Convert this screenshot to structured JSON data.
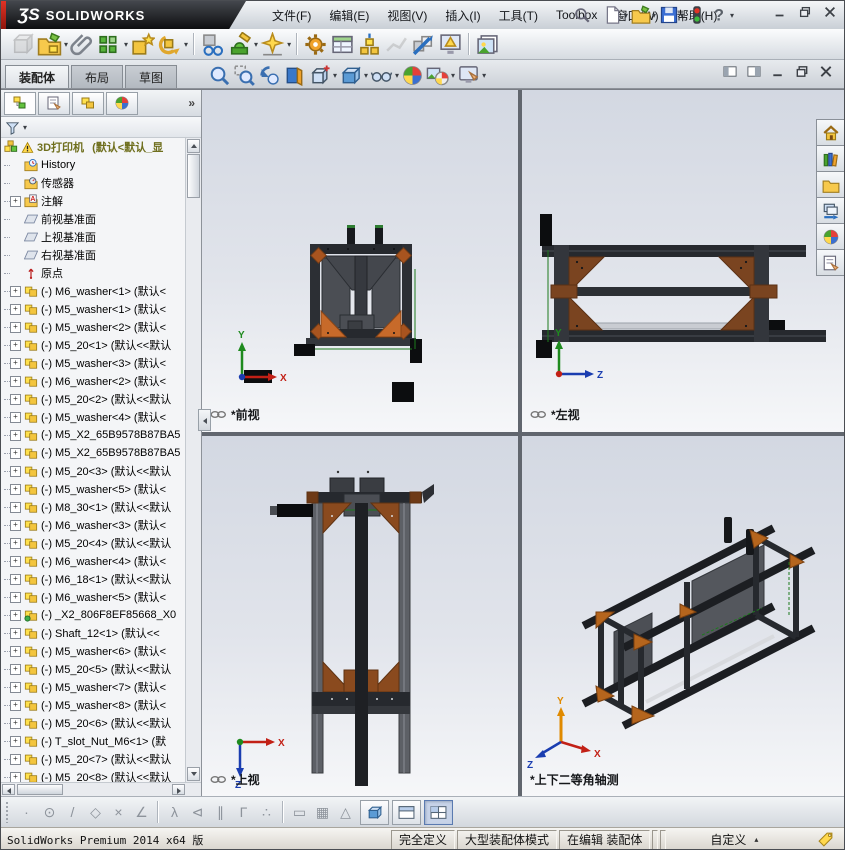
{
  "window": {
    "logo_glyph": "ƷS",
    "brand": "SOLIDWORKS",
    "menus": [
      "文件(F)",
      "编辑(E)",
      "视图(V)",
      "插入(I)",
      "工具(T)",
      "Toolbox",
      "窗口(W)",
      "帮助(H)"
    ],
    "quick_icons": [
      {
        "name": "new-document",
        "dropdown": true
      },
      {
        "name": "open-document",
        "dropdown": true
      },
      {
        "name": "save-document",
        "dropdown": true
      },
      {
        "name": "rebuild-indicator",
        "dropdown": false
      },
      {
        "name": "help",
        "dropdown": true
      }
    ],
    "controls": [
      {
        "name": "minimize"
      },
      {
        "name": "restore"
      },
      {
        "name": "close"
      }
    ]
  },
  "assembly_toolbar": [
    {
      "name": "insert-component",
      "disabled": true
    },
    {
      "name": "insert-components",
      "dropdown": true
    },
    {
      "name": "mate"
    },
    {
      "name": "linear-component-pattern",
      "dropdown": true
    },
    {
      "name": "smart-fasteners"
    },
    {
      "name": "move-component",
      "dropdown": true
    },
    {
      "sep": true
    },
    {
      "name": "show-hidden-components"
    },
    {
      "name": "assembly-features",
      "dropdown": true
    },
    {
      "name": "reference-geometry",
      "dropdown": true
    },
    {
      "sep": true
    },
    {
      "name": "new-motion-study"
    },
    {
      "name": "bill-of-materials"
    },
    {
      "name": "exploded-view"
    },
    {
      "name": "explode-line-sketch",
      "disabled": true
    },
    {
      "name": "interference-detection"
    },
    {
      "name": "assembly-visualization"
    },
    {
      "sep": true
    },
    {
      "name": "take-snapshot"
    }
  ],
  "command_tabs": [
    {
      "label": "装配体",
      "active": true
    },
    {
      "label": "布局",
      "active": false
    },
    {
      "label": "草图",
      "active": false
    }
  ],
  "view_toolbar": [
    {
      "name": "zoom-to-fit"
    },
    {
      "name": "zoom-to-area"
    },
    {
      "name": "previous-view"
    },
    {
      "name": "section-view"
    },
    {
      "name": "view-orientation",
      "dropdown": true
    },
    {
      "name": "display-style",
      "dropdown": true
    },
    {
      "name": "hide-show-items",
      "dropdown": true
    },
    {
      "name": "edit-appearance"
    },
    {
      "name": "apply-scene",
      "dropdown": true
    },
    {
      "name": "view-settings",
      "dropdown": true
    }
  ],
  "doc_controls": [
    {
      "name": "split-left"
    },
    {
      "name": "split-right"
    },
    {
      "name": "minimize"
    },
    {
      "name": "restore"
    },
    {
      "name": "close"
    }
  ],
  "feature_panel": {
    "tabs": [
      "featuremanager-tab",
      "propertymanager-tab",
      "configurationmanager-tab",
      "displaymanager-tab"
    ],
    "overflow": "»",
    "root": {
      "label": "3D打印机",
      "suffix": "(默认<默认_显"
    },
    "items": [
      {
        "icon": "history-folder",
        "label": "History"
      },
      {
        "icon": "sensors-folder",
        "label": "传感器"
      },
      {
        "icon": "annotations-folder",
        "label": "注解",
        "expand": true
      },
      {
        "icon": "plane",
        "label": "前视基准面"
      },
      {
        "icon": "plane",
        "label": "上视基准面"
      },
      {
        "icon": "plane",
        "label": "右视基准面"
      },
      {
        "icon": "origin",
        "label": "原点"
      },
      {
        "icon": "part",
        "label": "(-) M6_washer<1> (默认<",
        "expand": true
      },
      {
        "icon": "part",
        "label": "(-) M5_washer<1> (默认<",
        "expand": true
      },
      {
        "icon": "part",
        "label": "(-) M5_washer<2> (默认<",
        "expand": true
      },
      {
        "icon": "part",
        "label": "(-) M5_20<1> (默认<<默认",
        "expand": true
      },
      {
        "icon": "part",
        "label": "(-) M5_washer<3> (默认<",
        "expand": true
      },
      {
        "icon": "part",
        "label": "(-) M6_washer<2> (默认<",
        "expand": true
      },
      {
        "icon": "part",
        "label": "(-) M5_20<2> (默认<<默认",
        "expand": true
      },
      {
        "icon": "part",
        "label": "(-) M5_washer<4> (默认<",
        "expand": true
      },
      {
        "icon": "part",
        "label": "(-) M5_X2_65B9578B87BA5",
        "expand": true
      },
      {
        "icon": "part",
        "label": "(-) M5_X2_65B9578B87BA5",
        "expand": true
      },
      {
        "icon": "part",
        "label": "(-) M5_20<3> (默认<<默认",
        "expand": true
      },
      {
        "icon": "part",
        "label": "(-) M5_washer<5> (默认<",
        "expand": true
      },
      {
        "icon": "part",
        "label": "(-) M8_30<1> (默认<<默认",
        "expand": true
      },
      {
        "icon": "part",
        "label": "(-) M6_washer<3> (默认<",
        "expand": true
      },
      {
        "icon": "part",
        "label": "(-) M5_20<4> (默认<<默认",
        "expand": true
      },
      {
        "icon": "part",
        "label": "(-) M6_washer<4> (默认<",
        "expand": true
      },
      {
        "icon": "part",
        "label": "(-) M6_18<1> (默认<<默认",
        "expand": true
      },
      {
        "icon": "part",
        "label": "(-) M6_washer<5> (默认<",
        "expand": true
      },
      {
        "icon": "part-green",
        "label": "(-) _X2_806F8EF85668_X0",
        "expand": true
      },
      {
        "icon": "part",
        "label": "(-) Shaft_12<1> (默认<<",
        "expand": true
      },
      {
        "icon": "part",
        "label": "(-) M5_washer<6> (默认<",
        "expand": true
      },
      {
        "icon": "part",
        "label": "(-) M5_20<5> (默认<<默认",
        "expand": true
      },
      {
        "icon": "part",
        "label": "(-) M5_washer<7> (默认<",
        "expand": true
      },
      {
        "icon": "part",
        "label": "(-) M5_washer<8> (默认<",
        "expand": true
      },
      {
        "icon": "part",
        "label": "(-) M5_20<6> (默认<<默认",
        "expand": true
      },
      {
        "icon": "part",
        "label": "(-) T_slot_Nut_M6<1> (默",
        "expand": true
      },
      {
        "icon": "part",
        "label": "(-) M5_20<7> (默认<<默认",
        "expand": true
      },
      {
        "icon": "part",
        "label": "(-) M5_20<8> (默认<<默认",
        "expand": true
      }
    ]
  },
  "viewports": [
    {
      "label": "*前视",
      "linked": true
    },
    {
      "label": "*左视",
      "linked": true
    },
    {
      "label": "*上视",
      "linked": true
    },
    {
      "label": "*上下二等角轴测",
      "linked": false
    }
  ],
  "task_pane": [
    "solidworks-resources",
    "design-library",
    "file-explorer",
    "view-palette",
    "appearances-scenes",
    "custom-properties"
  ],
  "sketch_toolbar": [
    {
      "name": "sketch-point",
      "glyph": "·"
    },
    {
      "name": "sketch-circle",
      "glyph": "⊙"
    },
    {
      "name": "sketch-line",
      "glyph": "/"
    },
    {
      "name": "sketch-polygon",
      "glyph": "◇"
    },
    {
      "name": "sketch-trim",
      "glyph": "×"
    },
    {
      "name": "sketch-angle",
      "glyph": "∠"
    },
    {
      "sep": true
    },
    {
      "name": "relation-tangent",
      "glyph": "λ"
    },
    {
      "name": "relation-symmetric",
      "glyph": "⊲"
    },
    {
      "name": "relation-parallel",
      "glyph": "∥"
    },
    {
      "name": "relation-perpendicular",
      "glyph": "Γ"
    },
    {
      "name": "relation-coincident",
      "glyph": "∴"
    },
    {
      "sep": true
    },
    {
      "name": "dimension",
      "glyph": "▭"
    },
    {
      "name": "grid-settings",
      "glyph": "▦"
    },
    {
      "name": "angle-snap",
      "glyph": "△"
    }
  ],
  "view_layout_buttons": [
    {
      "name": "single-view",
      "active": false
    },
    {
      "name": "two-view",
      "active": false
    },
    {
      "name": "four-view",
      "active": true
    }
  ],
  "statusbar": {
    "left": "SolidWorks Premium 2014 x64 版",
    "cells": [
      "完全定义",
      "大型装配体模式",
      "在编辑 装配体"
    ],
    "custom": "自定义",
    "custom_arrow": "▴"
  }
}
